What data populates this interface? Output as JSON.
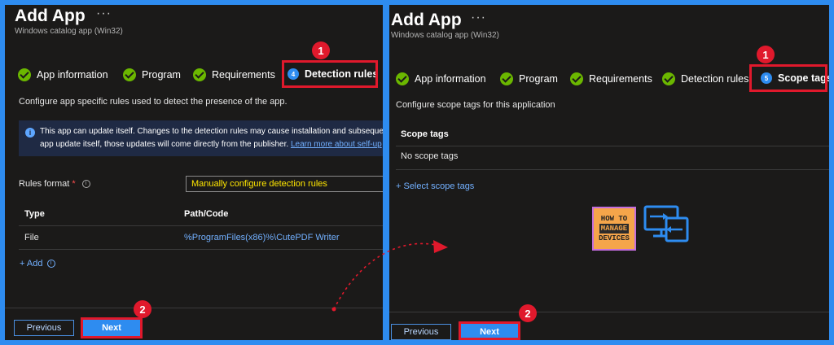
{
  "left": {
    "title": "Add App",
    "ellipsis": "···",
    "subtitle": "Windows catalog app (Win32)",
    "steps": [
      {
        "label": "App information",
        "state": "done"
      },
      {
        "label": "Program",
        "state": "done"
      },
      {
        "label": "Requirements",
        "state": "done"
      },
      {
        "label": "Detection rules",
        "state": "active",
        "number": "4"
      }
    ],
    "callout_step": "1",
    "description": "Configure app specific rules used to detect the presence of the app.",
    "info": {
      "icon": "i",
      "line1": "This app can update itself. Changes to the detection rules may cause installation and subsequen",
      "line2": "app update itself, those updates will come directly from the publisher. ",
      "link": "Learn more about self-up"
    },
    "rules_format": {
      "label": "Rules format",
      "required": "*",
      "info_icon": "i",
      "value": "Manually configure detection rules"
    },
    "table": {
      "headers": [
        "Type",
        "Path/Code"
      ],
      "rows": [
        [
          "File",
          "%ProgramFiles(x86)%\\CutePDF Writer"
        ]
      ]
    },
    "add_label": "+ Add",
    "add_info": "i",
    "previous_label": "Previous",
    "next_label": "Next",
    "callout_next": "2"
  },
  "right": {
    "title": "Add App",
    "ellipsis": "···",
    "subtitle": "Windows catalog app (Win32)",
    "steps": [
      {
        "label": "App information",
        "state": "done"
      },
      {
        "label": "Program",
        "state": "done"
      },
      {
        "label": "Requirements",
        "state": "done"
      },
      {
        "label": "Detection rules",
        "state": "done"
      },
      {
        "label": "Scope tags",
        "state": "active",
        "number": "5"
      }
    ],
    "callout_step": "1",
    "description": "Configure scope tags for this application",
    "table_header": "Scope tags",
    "table_row": "No scope tags",
    "select_link": "+ Select scope tags",
    "previous_label": "Previous",
    "next_label": "Next",
    "callout_next": "2"
  },
  "logo": {
    "line1": "HOW TO",
    "line2": "MANAGE",
    "line3": "DEVICES"
  },
  "colors": {
    "frame": "#2e8cf0",
    "panel": "#1b1a19",
    "check": "#6bb700",
    "callout": "#e0192c",
    "link": "#72b0ff",
    "accent": "#2e8cf0",
    "highlight_text": "#ffe600"
  },
  "icons": [
    "check-icon",
    "info-icon",
    "devices-icon",
    "arrow-icon"
  ]
}
